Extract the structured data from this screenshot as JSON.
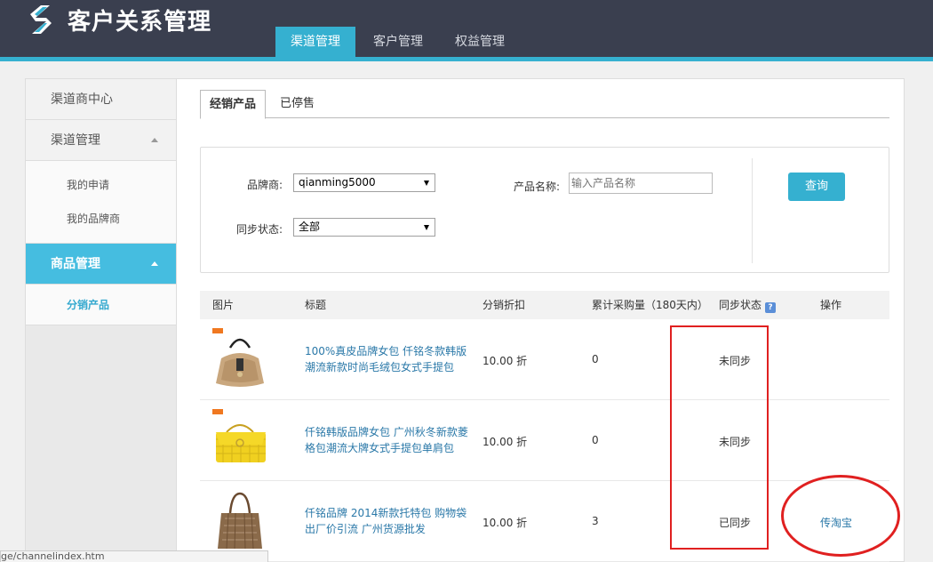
{
  "app": {
    "title": "客户关系管理"
  },
  "nav": {
    "tabs": [
      "渠道管理",
      "客户管理",
      "权益管理"
    ]
  },
  "sidebar": {
    "items": [
      {
        "label": "渠道商中心"
      },
      {
        "label": "渠道管理",
        "children": [
          "我的申请",
          "我的品牌商"
        ]
      },
      {
        "label": "商品管理",
        "children": [
          "分销产品"
        ]
      }
    ]
  },
  "tabs": [
    "经销产品",
    "已停售"
  ],
  "filter": {
    "brand_label": "品牌商:",
    "brand_value": "qianming5000",
    "product_label": "产品名称:",
    "product_placeholder": "输入产品名称",
    "sync_label": "同步状态:",
    "sync_value": "全部",
    "query_button": "查询"
  },
  "table": {
    "headers": [
      "图片",
      "标题",
      "分销折扣",
      "累计采购量（180天内）",
      "同步状态",
      "操作"
    ],
    "help_icon_glyph": "?",
    "rows": [
      {
        "title": "100%真皮品牌女包 仟铭冬款韩版潮流新款时尚毛绒包女式手提包",
        "discount": "10.00 折",
        "qty": "0",
        "status": "未同步",
        "op": "",
        "image": "beige-fur-handbag"
      },
      {
        "title": "仟铭韩版品牌女包 广州秋冬新款菱格包潮流大牌女式手提包单肩包",
        "discount": "10.00 折",
        "qty": "0",
        "status": "未同步",
        "op": "",
        "image": "yellow-quilted-bag"
      },
      {
        "title": "仟铭品牌 2014新款托特包 购物袋出厂价引流 广州货源批发",
        "discount": "10.00 折",
        "qty": "3",
        "status": "已同步",
        "op": "传淘宝",
        "image": "brown-tote-bag"
      }
    ]
  },
  "statusbar": {
    "text": "ge/channelindex.htm"
  },
  "colors": {
    "header": "#3a3f4f",
    "accent": "#35b0d0",
    "link": "#2a78a8",
    "annotation": "#e02020"
  }
}
